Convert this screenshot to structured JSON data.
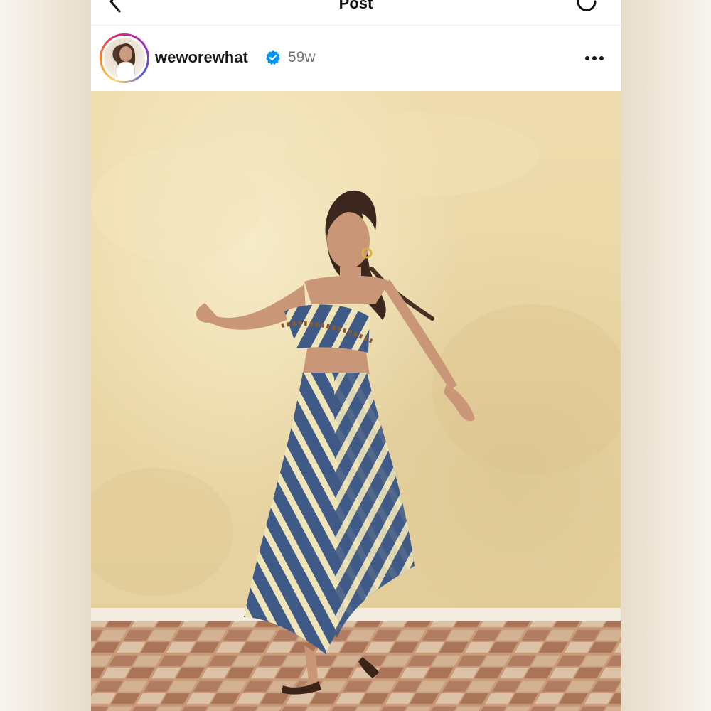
{
  "header": {
    "title": "Post"
  },
  "post": {
    "username": "weworewhat",
    "verified": true,
    "age": "59w"
  },
  "icons": {
    "back": "chevron-left-icon",
    "refresh": "refresh-icon",
    "verified": "verified-badge-icon",
    "more": "more-horizontal-icon"
  },
  "colors": {
    "verified_blue": "#0095f6",
    "text_primary": "#1a1a1a",
    "text_secondary": "#737373",
    "wall": "#ead7a6",
    "skirt_blue": "#3f5a86",
    "skirt_cream": "#efe4b8"
  }
}
